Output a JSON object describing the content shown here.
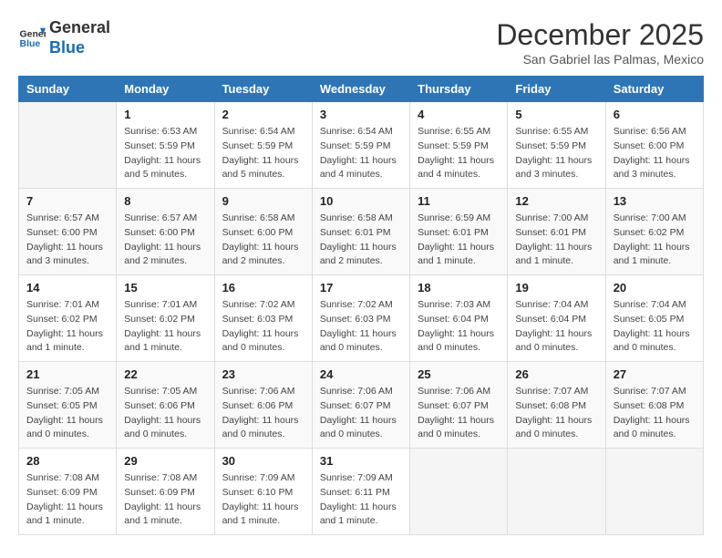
{
  "logo": {
    "line1": "General",
    "line2": "Blue"
  },
  "title": "December 2025",
  "subtitle": "San Gabriel las Palmas, Mexico",
  "days_header": [
    "Sunday",
    "Monday",
    "Tuesday",
    "Wednesday",
    "Thursday",
    "Friday",
    "Saturday"
  ],
  "weeks": [
    [
      {
        "day": "",
        "info": ""
      },
      {
        "day": "1",
        "info": "Sunrise: 6:53 AM\nSunset: 5:59 PM\nDaylight: 11 hours\nand 5 minutes."
      },
      {
        "day": "2",
        "info": "Sunrise: 6:54 AM\nSunset: 5:59 PM\nDaylight: 11 hours\nand 5 minutes."
      },
      {
        "day": "3",
        "info": "Sunrise: 6:54 AM\nSunset: 5:59 PM\nDaylight: 11 hours\nand 4 minutes."
      },
      {
        "day": "4",
        "info": "Sunrise: 6:55 AM\nSunset: 5:59 PM\nDaylight: 11 hours\nand 4 minutes."
      },
      {
        "day": "5",
        "info": "Sunrise: 6:55 AM\nSunset: 5:59 PM\nDaylight: 11 hours\nand 3 minutes."
      },
      {
        "day": "6",
        "info": "Sunrise: 6:56 AM\nSunset: 6:00 PM\nDaylight: 11 hours\nand 3 minutes."
      }
    ],
    [
      {
        "day": "7",
        "info": "Sunrise: 6:57 AM\nSunset: 6:00 PM\nDaylight: 11 hours\nand 3 minutes."
      },
      {
        "day": "8",
        "info": "Sunrise: 6:57 AM\nSunset: 6:00 PM\nDaylight: 11 hours\nand 2 minutes."
      },
      {
        "day": "9",
        "info": "Sunrise: 6:58 AM\nSunset: 6:00 PM\nDaylight: 11 hours\nand 2 minutes."
      },
      {
        "day": "10",
        "info": "Sunrise: 6:58 AM\nSunset: 6:01 PM\nDaylight: 11 hours\nand 2 minutes."
      },
      {
        "day": "11",
        "info": "Sunrise: 6:59 AM\nSunset: 6:01 PM\nDaylight: 11 hours\nand 1 minute."
      },
      {
        "day": "12",
        "info": "Sunrise: 7:00 AM\nSunset: 6:01 PM\nDaylight: 11 hours\nand 1 minute."
      },
      {
        "day": "13",
        "info": "Sunrise: 7:00 AM\nSunset: 6:02 PM\nDaylight: 11 hours\nand 1 minute."
      }
    ],
    [
      {
        "day": "14",
        "info": "Sunrise: 7:01 AM\nSunset: 6:02 PM\nDaylight: 11 hours\nand 1 minute."
      },
      {
        "day": "15",
        "info": "Sunrise: 7:01 AM\nSunset: 6:02 PM\nDaylight: 11 hours\nand 1 minute."
      },
      {
        "day": "16",
        "info": "Sunrise: 7:02 AM\nSunset: 6:03 PM\nDaylight: 11 hours\nand 0 minutes."
      },
      {
        "day": "17",
        "info": "Sunrise: 7:02 AM\nSunset: 6:03 PM\nDaylight: 11 hours\nand 0 minutes."
      },
      {
        "day": "18",
        "info": "Sunrise: 7:03 AM\nSunset: 6:04 PM\nDaylight: 11 hours\nand 0 minutes."
      },
      {
        "day": "19",
        "info": "Sunrise: 7:04 AM\nSunset: 6:04 PM\nDaylight: 11 hours\nand 0 minutes."
      },
      {
        "day": "20",
        "info": "Sunrise: 7:04 AM\nSunset: 6:05 PM\nDaylight: 11 hours\nand 0 minutes."
      }
    ],
    [
      {
        "day": "21",
        "info": "Sunrise: 7:05 AM\nSunset: 6:05 PM\nDaylight: 11 hours\nand 0 minutes."
      },
      {
        "day": "22",
        "info": "Sunrise: 7:05 AM\nSunset: 6:06 PM\nDaylight: 11 hours\nand 0 minutes."
      },
      {
        "day": "23",
        "info": "Sunrise: 7:06 AM\nSunset: 6:06 PM\nDaylight: 11 hours\nand 0 minutes."
      },
      {
        "day": "24",
        "info": "Sunrise: 7:06 AM\nSunset: 6:07 PM\nDaylight: 11 hours\nand 0 minutes."
      },
      {
        "day": "25",
        "info": "Sunrise: 7:06 AM\nSunset: 6:07 PM\nDaylight: 11 hours\nand 0 minutes."
      },
      {
        "day": "26",
        "info": "Sunrise: 7:07 AM\nSunset: 6:08 PM\nDaylight: 11 hours\nand 0 minutes."
      },
      {
        "day": "27",
        "info": "Sunrise: 7:07 AM\nSunset: 6:08 PM\nDaylight: 11 hours\nand 0 minutes."
      }
    ],
    [
      {
        "day": "28",
        "info": "Sunrise: 7:08 AM\nSunset: 6:09 PM\nDaylight: 11 hours\nand 1 minute."
      },
      {
        "day": "29",
        "info": "Sunrise: 7:08 AM\nSunset: 6:09 PM\nDaylight: 11 hours\nand 1 minute."
      },
      {
        "day": "30",
        "info": "Sunrise: 7:09 AM\nSunset: 6:10 PM\nDaylight: 11 hours\nand 1 minute."
      },
      {
        "day": "31",
        "info": "Sunrise: 7:09 AM\nSunset: 6:11 PM\nDaylight: 11 hours\nand 1 minute."
      },
      {
        "day": "",
        "info": ""
      },
      {
        "day": "",
        "info": ""
      },
      {
        "day": "",
        "info": ""
      }
    ]
  ]
}
